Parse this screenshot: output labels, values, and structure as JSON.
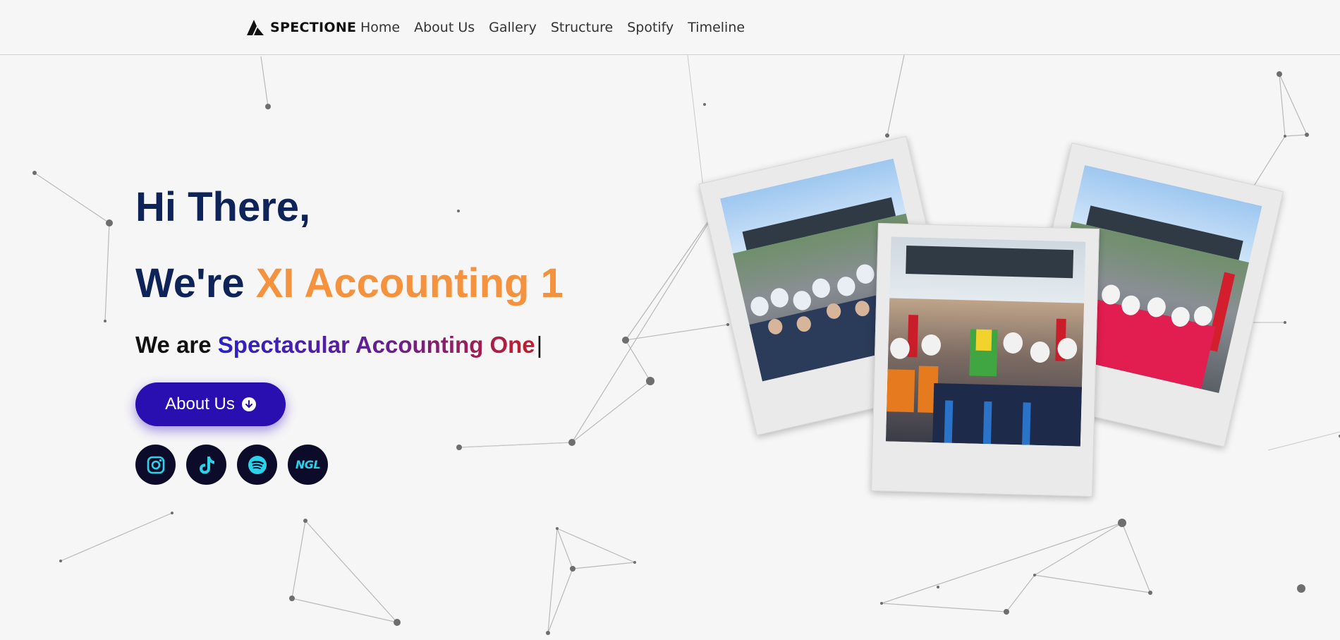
{
  "nav": {
    "brand": "SPECTIONE",
    "links": [
      "Home",
      "About Us",
      "Gallery",
      "Structure",
      "Spotify",
      "Timeline"
    ]
  },
  "hero": {
    "greeting": "Hi There,",
    "headline_prefix": "We're",
    "headline_accent": "XI Accounting 1",
    "tagline_prefix": "We are",
    "tagline_highlight": "Spectacular Accounting One",
    "cursor": "|",
    "button_label": "About Us"
  },
  "socials": [
    {
      "name": "instagram",
      "icon": "instagram-icon"
    },
    {
      "name": "tiktok",
      "icon": "tiktok-icon"
    },
    {
      "name": "spotify",
      "icon": "spotify-icon"
    },
    {
      "name": "ngl",
      "icon": "ngl-icon",
      "text": "NGL"
    }
  ],
  "colors": {
    "navy": "#0e2358",
    "orange_accent": "#f5923e",
    "button": "#2a0fb0",
    "social_bg": "#0c0b2a",
    "social_icon": "#2ad3e8",
    "gradient_start": "#2a20c8",
    "gradient_end": "#c41d2c"
  },
  "gallery": [
    "class-photo-left",
    "class-photo-center",
    "class-photo-right"
  ]
}
